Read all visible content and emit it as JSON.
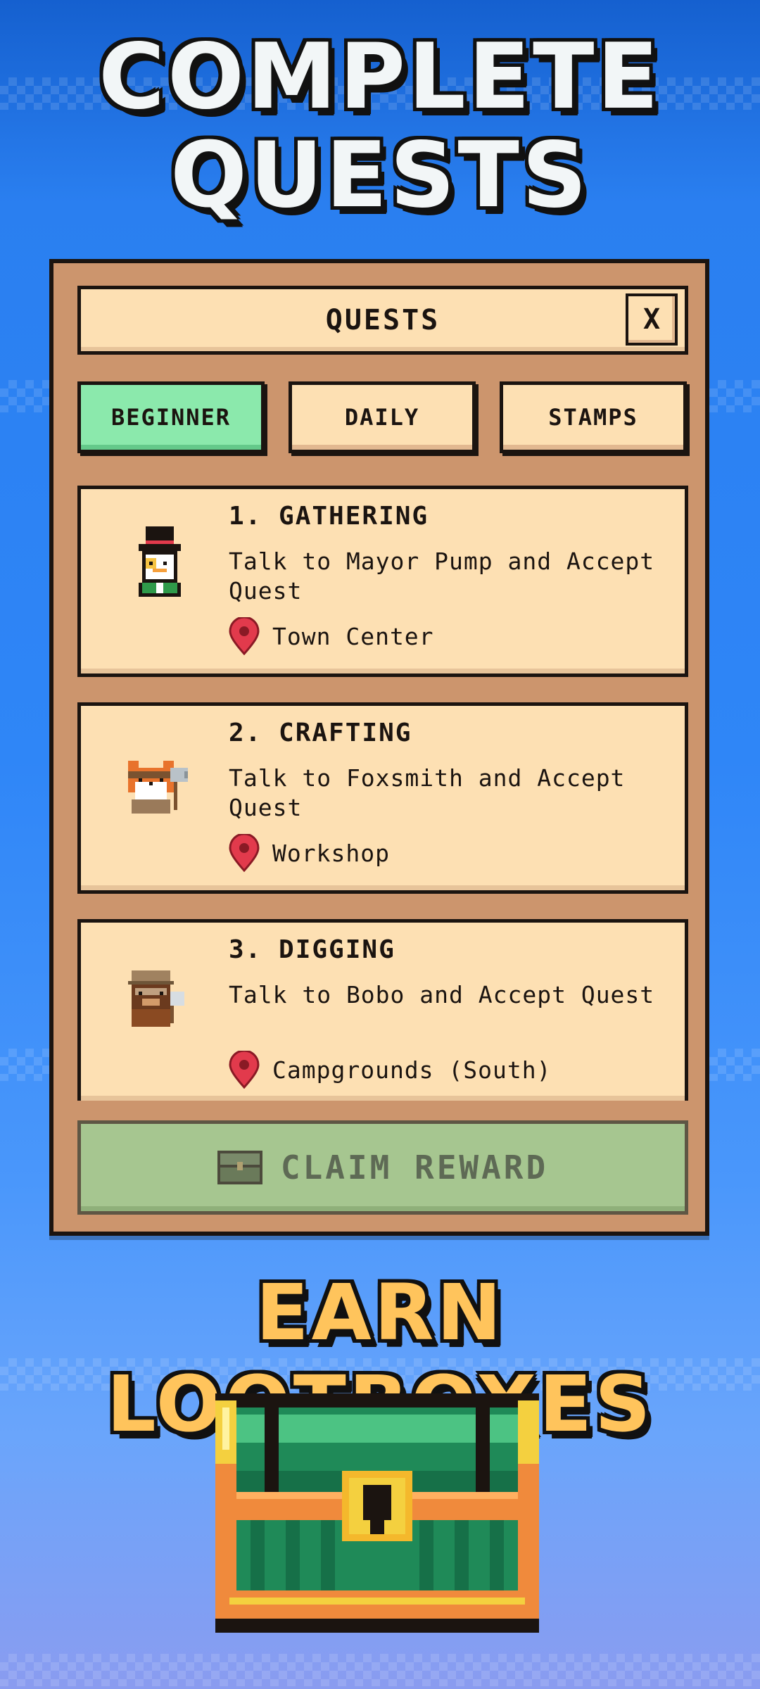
{
  "banner": {
    "line1": "COMPLETE",
    "line2": "QUESTS"
  },
  "panel": {
    "title": "QUESTS",
    "close_label": "X",
    "tabs": [
      {
        "label": "BEGINNER",
        "active": true
      },
      {
        "label": "DAILY",
        "active": false
      },
      {
        "label": "STAMPS",
        "active": false
      }
    ],
    "quests": [
      {
        "title": "1. GATHERING",
        "description": "Talk to Mayor Pump and Accept Quest",
        "location": "Town Center",
        "avatar": "mayor-pump-icon"
      },
      {
        "title": "2. CRAFTING",
        "description": "Talk to Foxsmith and Accept Quest",
        "location": "Workshop",
        "avatar": "foxsmith-icon"
      },
      {
        "title": "3. DIGGING",
        "description": "Talk to Bobo and Accept Quest",
        "location": "Campgrounds (South)",
        "avatar": "bobo-icon"
      }
    ],
    "claim_label": "CLAIM REWARD",
    "claim_enabled": false
  },
  "promo": {
    "text": "EARN LOOTBOXES",
    "chest_icon": "treasure-chest-icon"
  },
  "colors": {
    "active_tab": "#8be9ac",
    "card_bg": "#fde0b3",
    "panel_bg": "#cc956d",
    "pin": "#e23a4c",
    "promo_text": "#ffc45c"
  }
}
